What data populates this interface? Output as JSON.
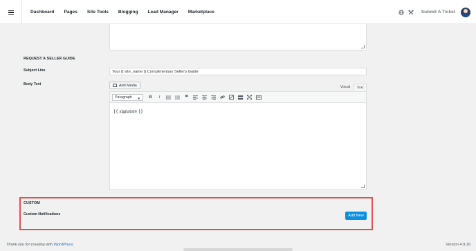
{
  "nav": {
    "items": [
      {
        "label": "Dashboard"
      },
      {
        "label": "Pages"
      },
      {
        "label": "Site Tools"
      },
      {
        "label": "Blogging"
      },
      {
        "label": "Lead Manager"
      },
      {
        "label": "Marketplace"
      }
    ],
    "submit_ticket": "Submit A Ticket"
  },
  "seller_guide": {
    "heading": "REQUEST A SELLER GUIDE",
    "subject_label": "Subject Line",
    "subject_value": "Your {{ site_name }} Complimentary Seller's Guide",
    "body_label": "Body Text",
    "add_media": "Add Media",
    "tab_visual": "Visual",
    "tab_text": "Text",
    "format_selected": "Paragraph",
    "editor_content": "{{ signature }}"
  },
  "custom": {
    "heading": "CUSTOM",
    "notifications_label": "Custom Notifications",
    "add_new": "Add New"
  },
  "footer": {
    "thanks_prefix": "Thank you for creating with ",
    "thanks_link": "WordPress",
    "thanks_suffix": ".",
    "version": "Version 4.9.16"
  },
  "colors": {
    "accent": "#0b8fe0",
    "highlight": "#d9534f"
  }
}
